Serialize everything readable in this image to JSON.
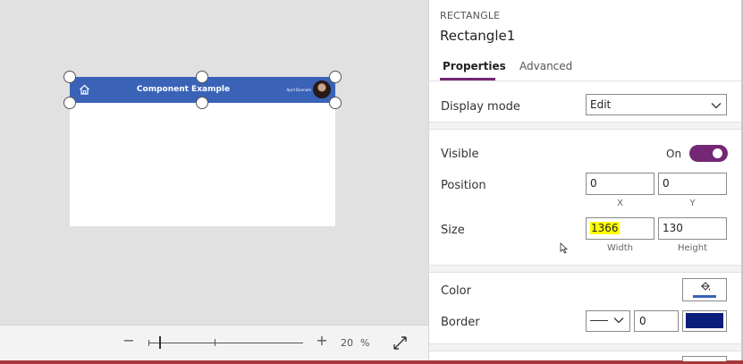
{
  "canvas": {
    "header": {
      "title": "Component Example",
      "user_name": "April Dunnam",
      "bar_color": "#3a63b8"
    },
    "icons": {
      "home": "home-icon",
      "avatar": "user-avatar"
    }
  },
  "zoom_bar": {
    "minus": "−",
    "plus": "+",
    "zoom_value": "20",
    "zoom_unit": "%",
    "zoom_level": 0.2,
    "fullscreen_icon": "fullscreen-icon"
  },
  "panel": {
    "control_type": "RECTANGLE",
    "control_name": "Rectangle1",
    "tabs": [
      {
        "label": "Properties",
        "active": true
      },
      {
        "label": "Advanced",
        "active": false
      }
    ],
    "display_mode": {
      "label": "Display mode",
      "value": "Edit"
    },
    "visible": {
      "label": "Visible",
      "state_text": "On",
      "on": true
    },
    "position": {
      "label": "Position",
      "x": "0",
      "y": "0",
      "x_label": "X",
      "y_label": "Y"
    },
    "size": {
      "label": "Size",
      "width": "1366",
      "height": "130",
      "width_label": "Width",
      "height_label": "Height"
    },
    "color": {
      "label": "Color",
      "value": "#3a63b8"
    },
    "border": {
      "label": "Border",
      "width": "0",
      "color": "#0a1e7a"
    }
  },
  "colors": {
    "accent": "#742774",
    "bottom_accent": "#a4373a"
  }
}
